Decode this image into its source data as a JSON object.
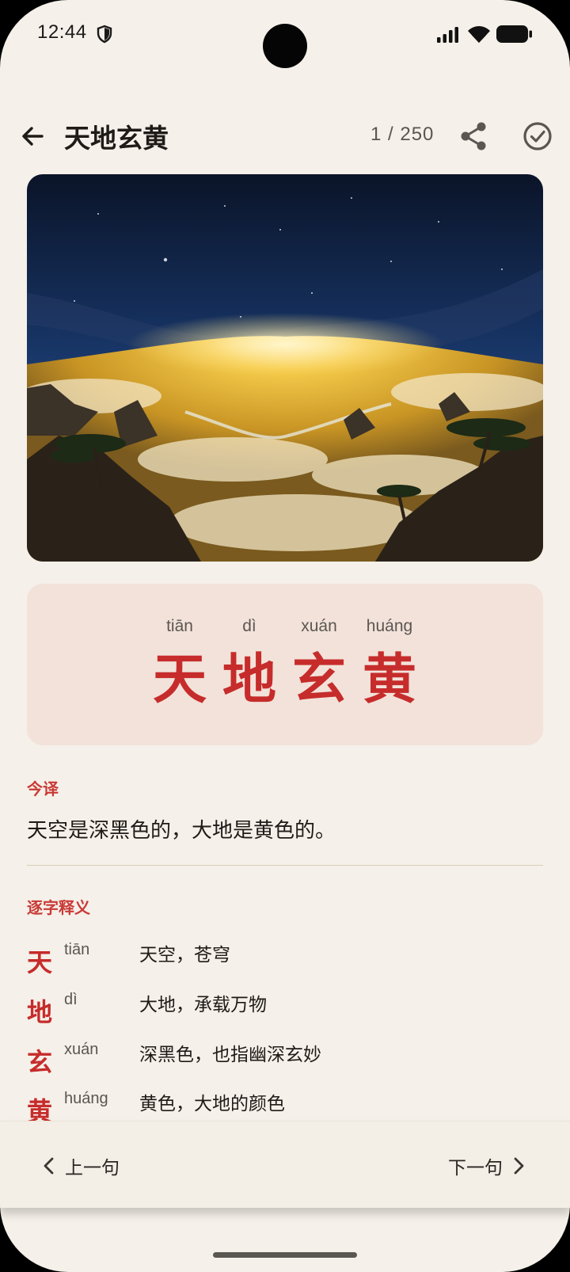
{
  "status_bar": {
    "time": "12:44"
  },
  "header": {
    "title": "天地玄黄",
    "progress": "1 / 250"
  },
  "verse": {
    "chars": [
      {
        "han": "天",
        "pinyin": "tiān"
      },
      {
        "han": "地",
        "pinyin": "dì"
      },
      {
        "han": "玄",
        "pinyin": "xuán"
      },
      {
        "han": "黄",
        "pinyin": "huáng"
      }
    ],
    "accent_color": "#c62c2b"
  },
  "translation": {
    "label": "今译",
    "text": "天空是深黑色的，大地是黄色的。"
  },
  "glossary": {
    "label": "逐字释义",
    "items": [
      {
        "char": "天",
        "pinyin": "tiān",
        "definition": "天空，苍穹"
      },
      {
        "char": "地",
        "pinyin": "dì",
        "definition": "大地，承载万物"
      },
      {
        "char": "玄",
        "pinyin": "xuán",
        "definition": "深黑色，也指幽深玄妙"
      },
      {
        "char": "黄",
        "pinyin": "huáng",
        "definition": "黄色，大地的颜色"
      }
    ]
  },
  "bottom_nav": {
    "prev_label": "上一句",
    "next_label": "下一句"
  },
  "icons": {
    "back": "arrow-back-icon",
    "share": "share-icon",
    "done": "check-circle-icon",
    "prev": "chevron-left-icon",
    "next": "chevron-right-icon"
  }
}
